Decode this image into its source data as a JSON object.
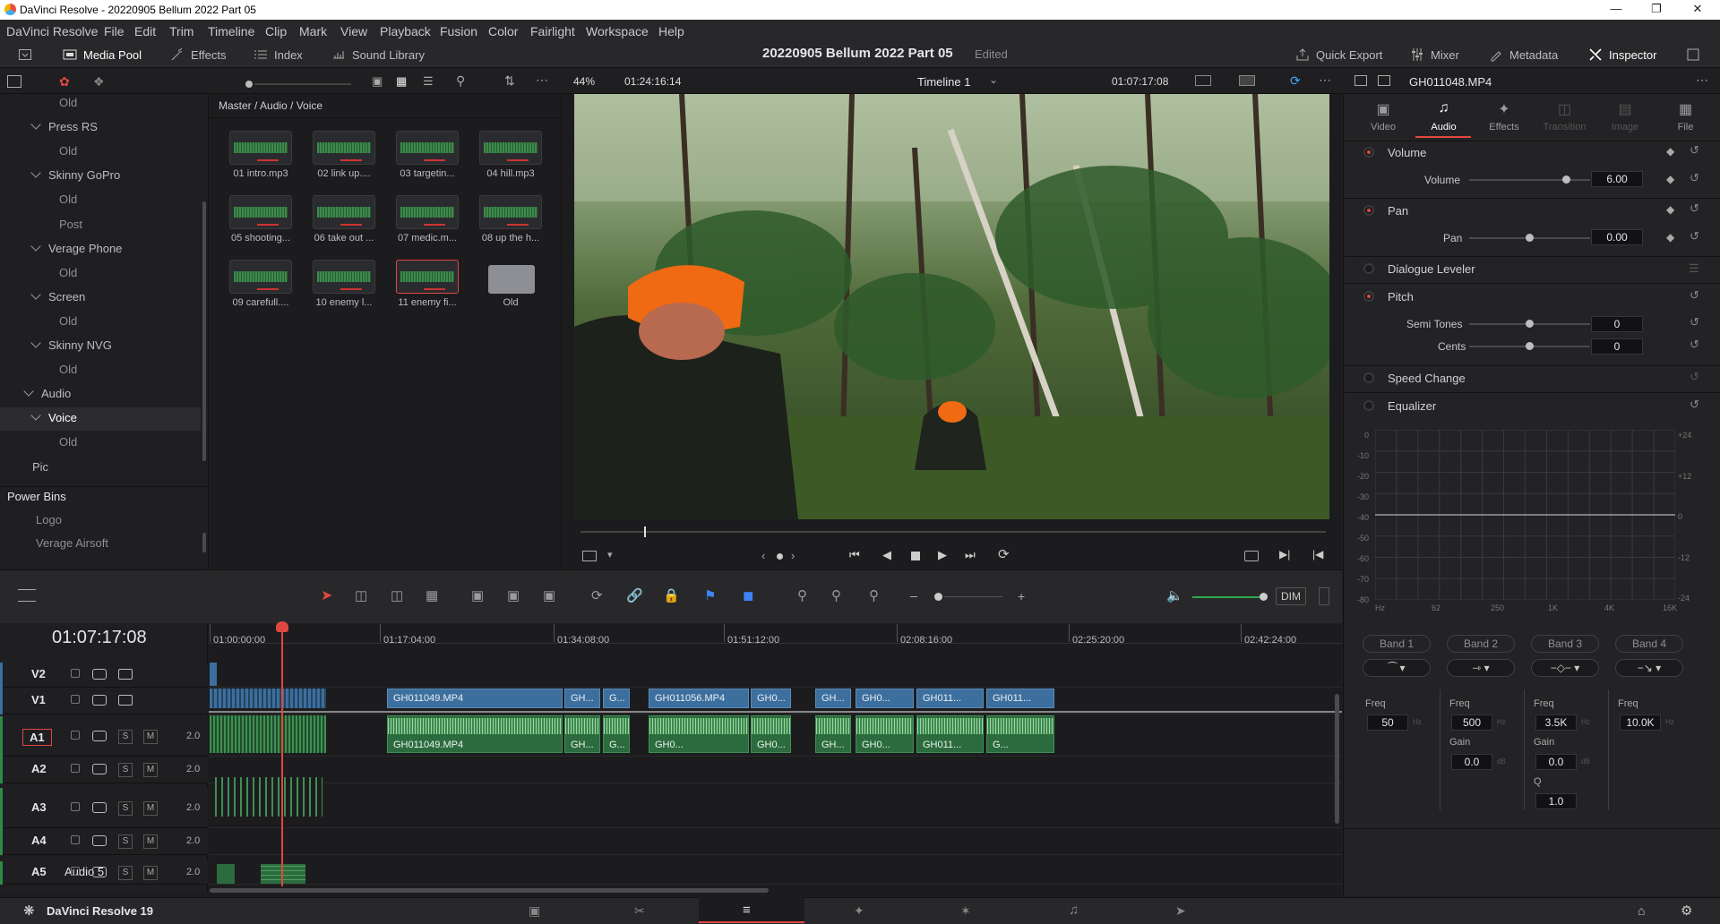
{
  "window": {
    "title": "DaVinci Resolve - 20220905 Bellum 2022 Part 05"
  },
  "menu": [
    "DaVinci Resolve",
    "File",
    "Edit",
    "Trim",
    "Timeline",
    "Clip",
    "Mark",
    "View",
    "Playback",
    "Fusion",
    "Color",
    "Fairlight",
    "Workspace",
    "Help"
  ],
  "toolbar": {
    "media_pool": "Media Pool",
    "effects": "Effects",
    "index": "Index",
    "sound_library": "Sound Library",
    "project_title": "20220905 Bellum 2022 Part 05",
    "project_status": "Edited",
    "quick_export": "Quick Export",
    "mixer": "Mixer",
    "metadata": "Metadata",
    "inspector": "Inspector"
  },
  "viewer": {
    "zoom": "44%",
    "source_tc": "01:24:16:14",
    "timeline_name": "Timeline 1",
    "record_tc": "01:07:17:08"
  },
  "bins": [
    {
      "label": "Old",
      "level": 3
    },
    {
      "label": "Press RS",
      "level": 2
    },
    {
      "label": "Old",
      "level": 3
    },
    {
      "label": "Skinny GoPro",
      "level": 2
    },
    {
      "label": "Old",
      "level": 3
    },
    {
      "label": "Post",
      "level": 3
    },
    {
      "label": "Verage Phone",
      "level": 2
    },
    {
      "label": "Old",
      "level": 3
    },
    {
      "label": "Screen",
      "level": 2
    },
    {
      "label": "Old",
      "level": 3
    },
    {
      "label": "Skinny NVG",
      "level": 2
    },
    {
      "label": "Old",
      "level": 3
    },
    {
      "label": "Audio",
      "level": 1
    },
    {
      "label": "Voice",
      "level": 2
    },
    {
      "label": "Old",
      "level": 3
    },
    {
      "label": "Pic",
      "level": 2
    }
  ],
  "power_bins": {
    "title": "Power Bins",
    "items": [
      "Logo",
      "Verage Airsoft"
    ]
  },
  "media": {
    "breadcrumb": "Master / Audio / Voice",
    "clips": [
      "01 intro.mp3",
      "02 link up....",
      "03 targetin...",
      "04 hill.mp3",
      "05 shooting...",
      "06 take out ...",
      "07 medic.m...",
      "08 up the h...",
      "09 carefull....",
      "10 enemy l...",
      "11 enemy fi...",
      "Old"
    ]
  },
  "inspector": {
    "clip_name": "GH011048.MP4",
    "tabs": [
      "Video",
      "Audio",
      "Effects",
      "Transition",
      "Image",
      "File"
    ],
    "volume": {
      "section": "Volume",
      "label": "Volume",
      "value": "6.00"
    },
    "pan": {
      "section": "Pan",
      "label": "Pan",
      "value": "0.00"
    },
    "dialogue": "Dialogue Leveler",
    "pitch": {
      "section": "Pitch",
      "semi_label": "Semi Tones",
      "semi": "0",
      "cents_label": "Cents",
      "cents": "0"
    },
    "speed": "Speed Change",
    "eq": {
      "section": "Equalizer",
      "left_axis": [
        "0",
        "-10",
        "-20",
        "-30",
        "-40",
        "-50",
        "-60",
        "-70",
        "-80"
      ],
      "right_axis": [
        "+24",
        "+12",
        "0",
        "-12",
        "-24"
      ],
      "freq_axis": [
        "Hz",
        "62",
        "250",
        "1K",
        "4K",
        "16K"
      ],
      "bands": [
        {
          "name": "Band 1",
          "freq_label": "Freq",
          "freq": "50",
          "unit": "Hz"
        },
        {
          "name": "Band 2",
          "freq_label": "Freq",
          "freq": "500",
          "unit": "Hz",
          "gain_label": "Gain",
          "gain": "0.0",
          "gain_unit": "dB"
        },
        {
          "name": "Band 3",
          "freq_label": "Freq",
          "freq": "3.5K",
          "unit": "Hz",
          "gain_label": "Gain",
          "gain": "0.0",
          "gain_unit": "dB",
          "q_label": "Q",
          "q": "1.0"
        },
        {
          "name": "Band 4",
          "freq_label": "Freq",
          "freq": "10.0K",
          "unit": "Hz"
        }
      ]
    }
  },
  "timeline": {
    "timecode": "01:07:17:08",
    "dim": "DIM",
    "ruler": [
      "01:00:00:00",
      "01:17:04:00",
      "01:34:08:00",
      "01:51:12:00",
      "02:08:16:00",
      "02:25:20:00",
      "02:42:24:00"
    ],
    "tracks": [
      {
        "id": "V2",
        "name": ""
      },
      {
        "id": "V1",
        "name": ""
      },
      {
        "id": "A1",
        "name": "",
        "level": "2.0"
      },
      {
        "id": "A2",
        "name": "",
        "level": "2.0"
      },
      {
        "id": "A3",
        "name": "",
        "level": "2.0"
      },
      {
        "id": "A4",
        "name": "",
        "level": "2.0"
      },
      {
        "id": "A5",
        "name": "Audio 5",
        "level": "2.0"
      }
    ],
    "video_clips": [
      "GH011049.MP4",
      "GH...",
      "G...",
      "GH011056.MP4",
      "GH0...",
      "GH...",
      "GH0...",
      "GH011...",
      "GH011..."
    ],
    "audio_clips": [
      "GH011049.MP4",
      "GH...",
      "G...",
      "GH0...",
      "GH0...",
      "GH...",
      "GH0...",
      "GH011...",
      "G..."
    ]
  },
  "footer": {
    "app": "DaVinci Resolve 19"
  }
}
